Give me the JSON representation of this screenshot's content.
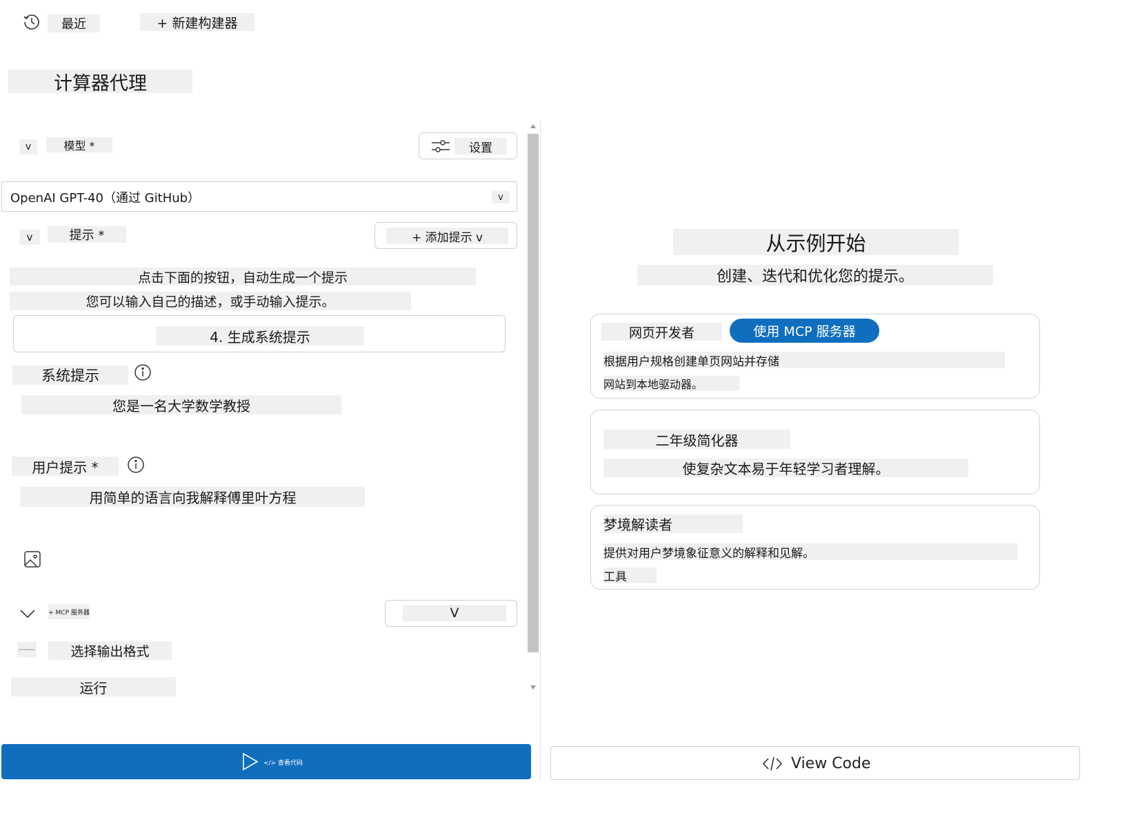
{
  "header": {
    "recent_label": "最近",
    "new_builder_label": "+ 新建构建器"
  },
  "agent": {
    "title": "计算器代理"
  },
  "model": {
    "toggle": "v",
    "label": "模型 *",
    "settings_label": "设置",
    "selected": "OpenAI GPT-40（通过 GitHub）",
    "dropdown_caret": "v"
  },
  "prompt": {
    "toggle": "v",
    "label": "提示 *",
    "add_prompt_label": "+ 添加提示 v",
    "hint_line1": "点击下面的按钮，自动生成一个提示",
    "hint_line2": "您可以输入自己的描述，或手动输入提示。",
    "generate_button": "4. 生成系统提示",
    "system_label": "系统提示",
    "system_value": "您是一名大学数学教授",
    "user_label": "用户提示 *",
    "user_value": "用简单的语言向我解释傅里叶方程"
  },
  "mcp": {
    "label": "+ MCP 服务器",
    "dropdown": "V"
  },
  "output": {
    "label": "选择输出格式"
  },
  "run": {
    "label": "运行"
  },
  "bottom_left": {
    "view_code_small": "</> 查看代码"
  },
  "right": {
    "title": "从示例开始",
    "subtitle": "创建、迭代和优化您的提示。",
    "cards": [
      {
        "title": "网页开发者",
        "badge": "使用 MCP 服务器",
        "desc_line1": "根据用户规格创建单页网站并存储",
        "desc_line2": "网站到本地驱动器。"
      },
      {
        "title": "二年级简化器",
        "desc_line1": "使复杂文本易于年轻学习者理解。"
      },
      {
        "title": "梦境解读者",
        "desc_line1": "提供对用户梦境象征意义的解释和见解。",
        "desc_line2": "工具"
      }
    ],
    "view_code_label": "View Code"
  },
  "colors": {
    "accent": "#106ebe",
    "placeholder_bg": "#f0f0f0"
  }
}
